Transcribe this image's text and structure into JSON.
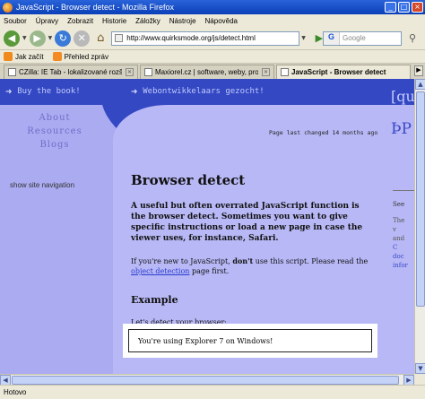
{
  "window": {
    "title": "JavaScript - Browser detect - Mozilla Firefox",
    "minimize": "_",
    "maximize": "□",
    "close": "×"
  },
  "menu": [
    "Soubor",
    "Úpravy",
    "Zobrazit",
    "Historie",
    "Záložky",
    "Nástroje",
    "Nápověda"
  ],
  "toolbar": {
    "url": "http://www.quirksmode.org/js/detect.html",
    "search_placeholder": "Google",
    "search_engine": "G"
  },
  "bookmarks": [
    {
      "label": "Jak začít",
      "icon": "firefox-icon"
    },
    {
      "label": "Přehled zpráv",
      "icon": "rss-icon"
    }
  ],
  "tabs": [
    {
      "label": "CZilla: IE Tab - lokalizované rozšíření",
      "active": false
    },
    {
      "label": "Maxiorel.cz | software, weby, progr...",
      "active": false
    },
    {
      "label": "JavaScript - Browser detect",
      "active": true
    }
  ],
  "page": {
    "ad_left": "Buy the book!",
    "ad_right": "Webontwikkelaars gezocht!",
    "logo_fragment_top": "[qu",
    "logo_fragment_bottom": "ÞP",
    "nav": [
      "About",
      "Resources",
      "Blogs"
    ],
    "last_changed": "Page last changed 14 months ago",
    "show_site_navigation": "show site navigation",
    "heading": "Browser detect",
    "lead": "A useful but often overrated JavaScript function is the browser detect. Sometimes you want to give specific instructions or load a new page in case the viewer uses, for instance, Safari.",
    "para_prefix": "If you're new to JavaScript, ",
    "para_strong": "don't",
    "para_middle": " use this script. Please read the ",
    "para_link": "object detection",
    "para_suffix": " page first.",
    "example_heading": "Example",
    "lets_detect": "Let's detect your browser:",
    "result": "You're using Explorer 7 on Windows!",
    "right_col": [
      "See",
      "The",
      "v",
      "and",
      "C",
      "doc",
      "infor"
    ]
  },
  "status": "Hotovo",
  "colors": {
    "page_bg": "#ababf2",
    "band": "#3348c2",
    "link": "#2a3ccf"
  }
}
